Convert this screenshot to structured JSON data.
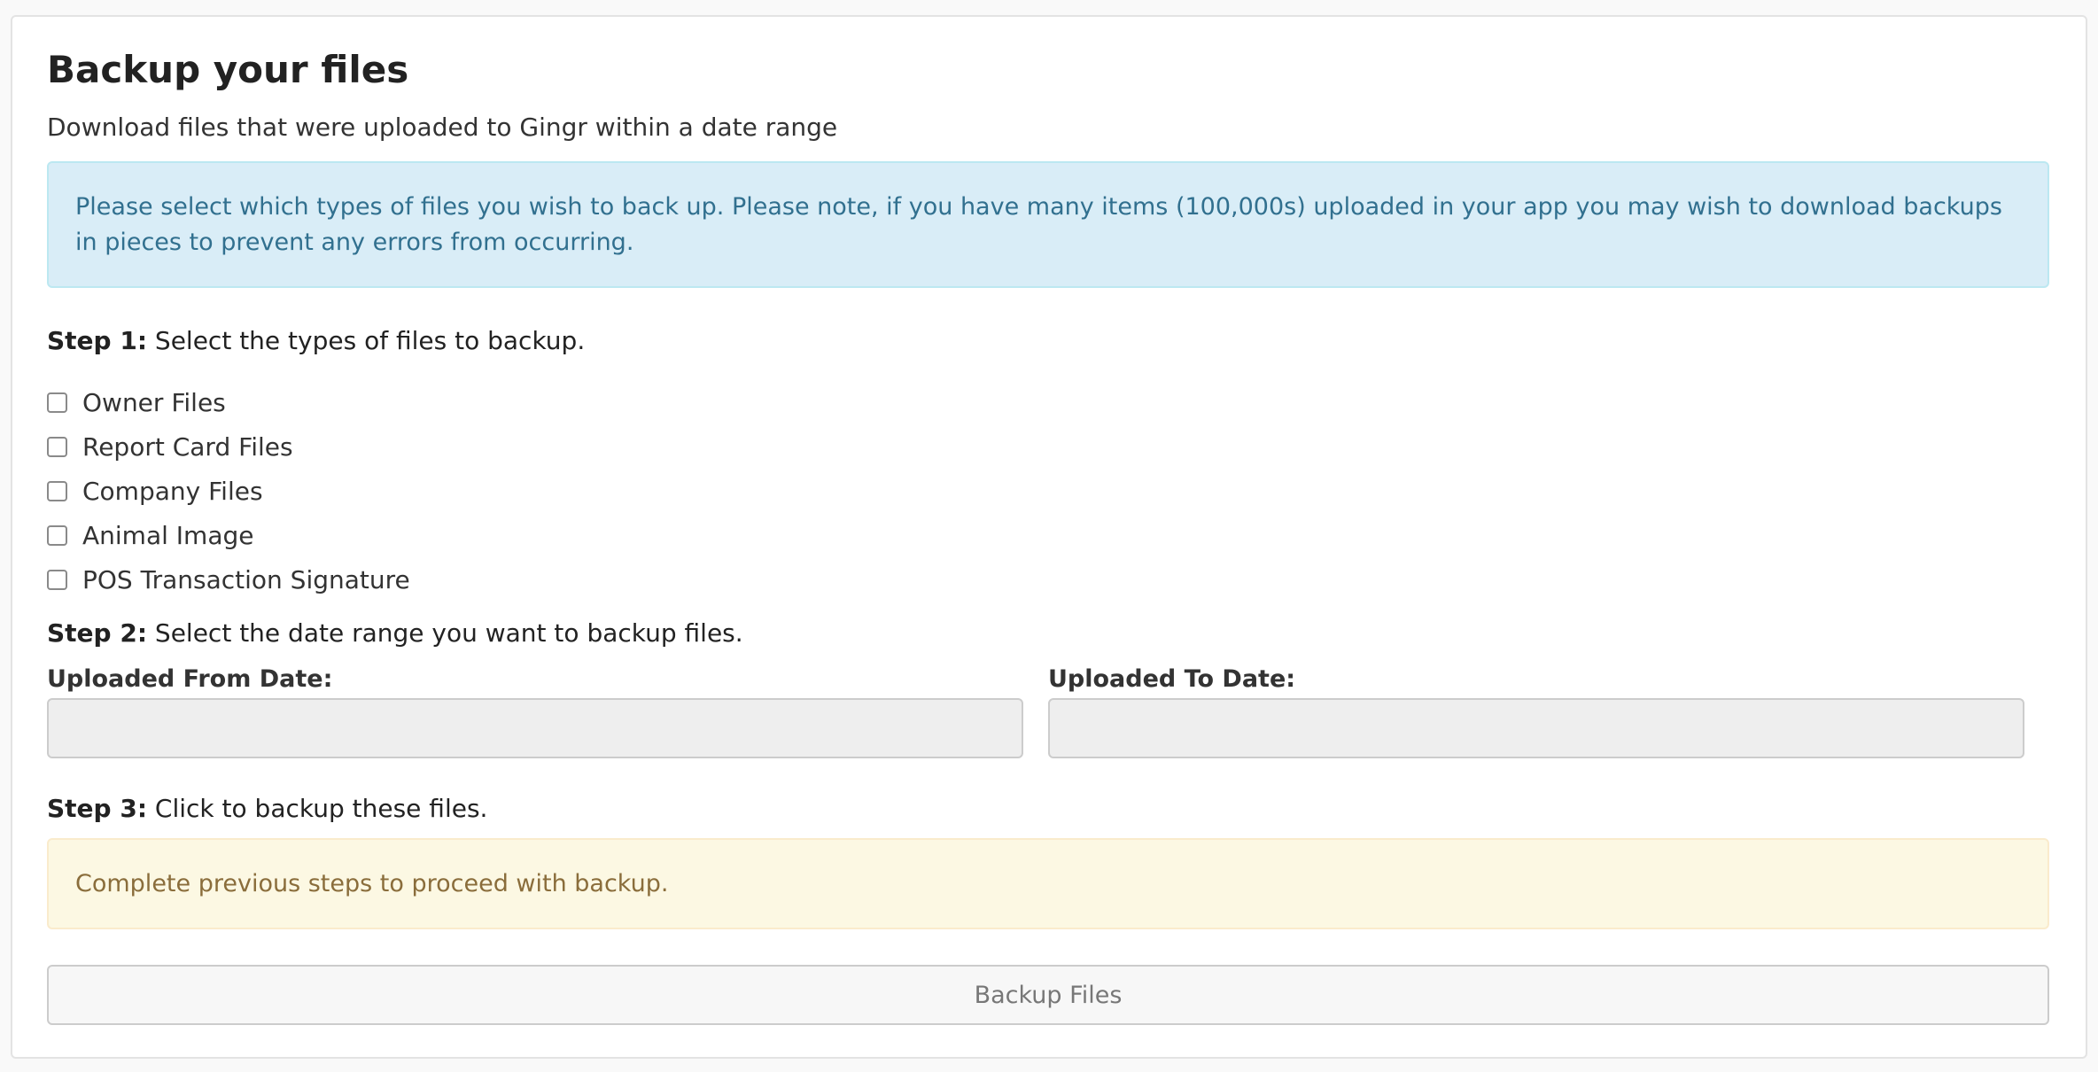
{
  "page": {
    "title": "Backup your files",
    "subtitle": "Download files that were uploaded to Gingr within a date range"
  },
  "info_alert": {
    "text": "Please select which types of files you wish to back up. Please note, if you have many items (100,000s) uploaded in your app you may wish to download backups in pieces to prevent any errors from occurring."
  },
  "step1": {
    "label": "Step 1:",
    "text": " Select the types of files to backup.",
    "file_types": [
      {
        "label": "Owner Files",
        "checked": false
      },
      {
        "label": "Report Card Files",
        "checked": false
      },
      {
        "label": "Company Files",
        "checked": false
      },
      {
        "label": "Animal Image",
        "checked": false
      },
      {
        "label": "POS Transaction Signature",
        "checked": false
      }
    ]
  },
  "step2": {
    "label": "Step 2:",
    "text": " Select the date range you want to backup files.",
    "from_label": "Uploaded From Date:",
    "from_value": "",
    "to_label": "Uploaded To Date:",
    "to_value": ""
  },
  "step3": {
    "label": "Step 3:",
    "text": " Click to backup these files."
  },
  "warning_alert": {
    "text": "Complete previous steps to proceed with backup."
  },
  "backup_button": {
    "label": "Backup Files",
    "disabled": true
  },
  "colors": {
    "info_bg": "#d9edf7",
    "info_text": "#31708f",
    "warning_bg": "#fcf8e3",
    "warning_text": "#8a6d3b",
    "input_disabled_bg": "#eeeeee"
  }
}
